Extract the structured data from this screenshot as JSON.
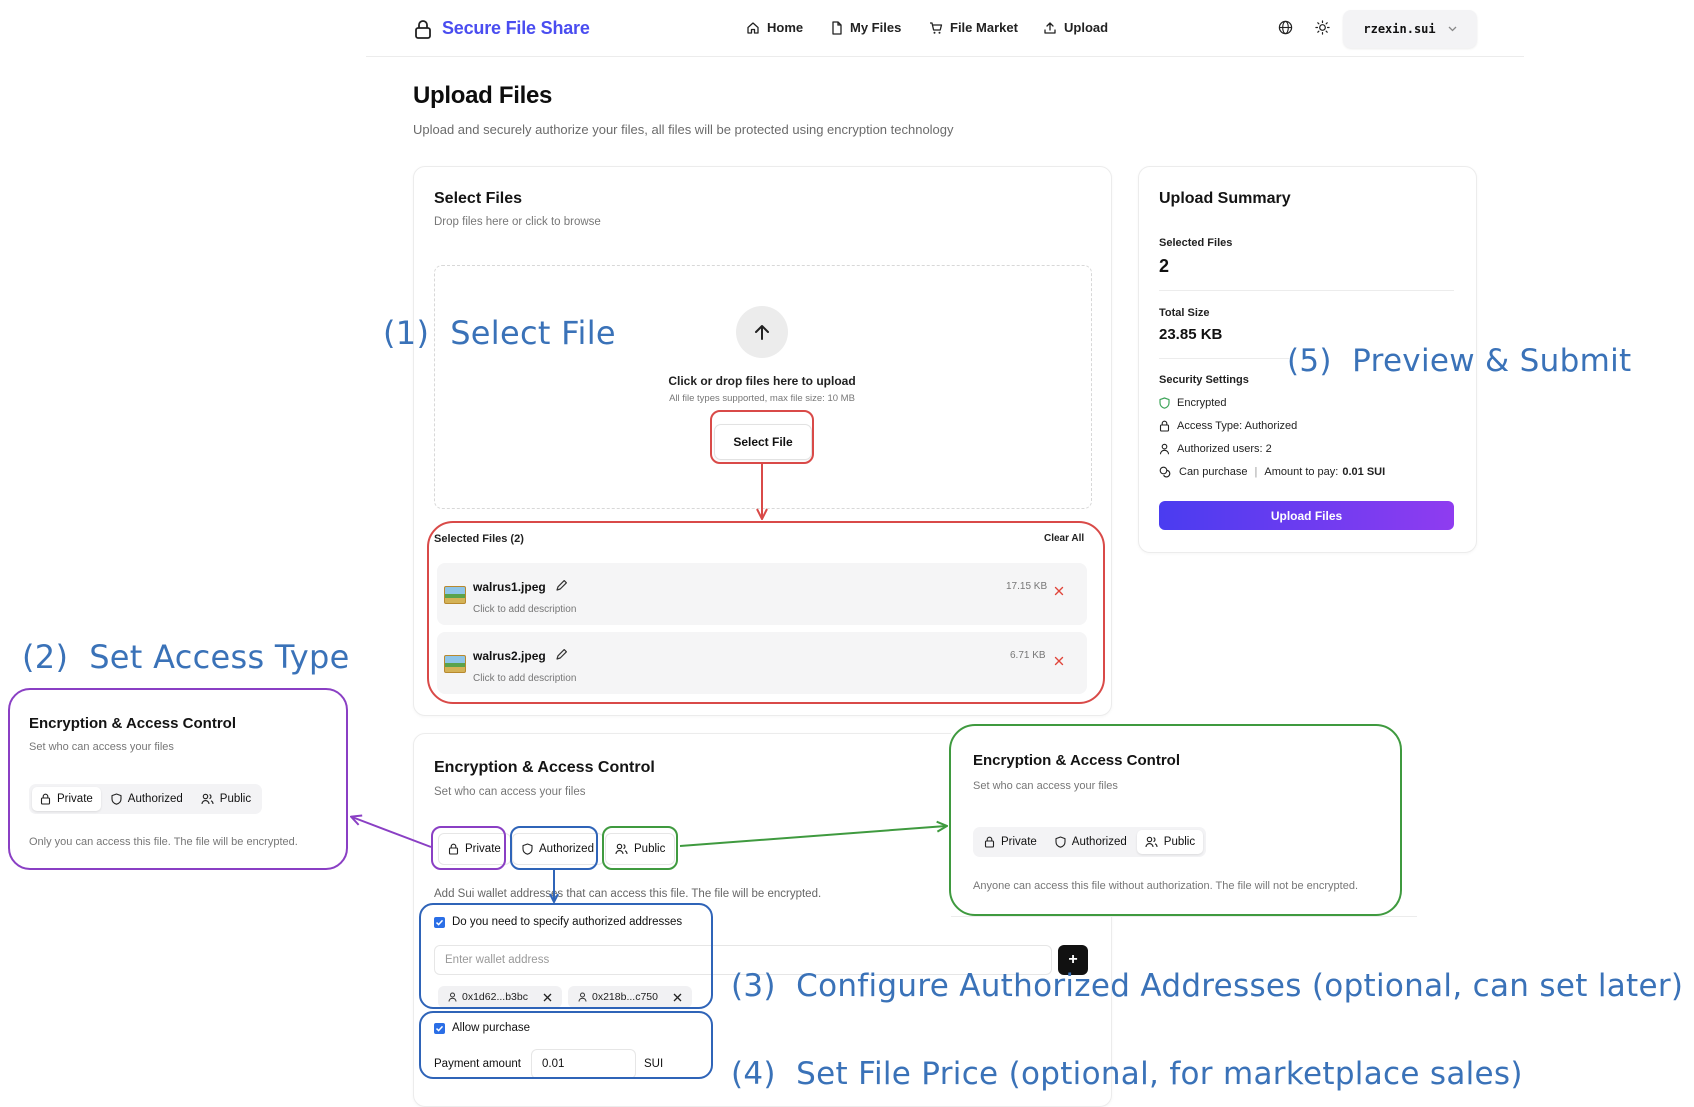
{
  "header": {
    "brand": "Secure File Share",
    "nav": [
      {
        "label": "Home",
        "icon": "home-icon"
      },
      {
        "label": "My Files",
        "icon": "file-icon"
      },
      {
        "label": "File Market",
        "icon": "cart-icon"
      },
      {
        "label": "Upload",
        "icon": "upload-icon"
      }
    ],
    "user": "rzexin.sui"
  },
  "page": {
    "title": "Upload Files",
    "subtitle": "Upload and securely authorize your files, all files will be protected using encryption technology"
  },
  "select_files": {
    "title": "Select Files",
    "subtitle": "Drop files here or click to browse",
    "drop_title": "Click or drop files here to upload",
    "drop_sub": "All file types supported, max file size: 10 MB",
    "select_button": "Select File",
    "selected_heading": "Selected Files (2)",
    "clear_all": "Clear All",
    "files": [
      {
        "name": "walrus1.jpeg",
        "description": "Click to add description",
        "size": "17.15 KB"
      },
      {
        "name": "walrus2.jpeg",
        "description": "Click to add description",
        "size": "6.71 KB"
      }
    ]
  },
  "access": {
    "title": "Encryption & Access Control",
    "subtitle": "Set who can access your files",
    "options": [
      "Private",
      "Authorized",
      "Public"
    ],
    "authorized_hint": "Add Sui wallet addresses that can access this file. The file will be encrypted.",
    "specify_label": "Do you need to specify authorized addresses",
    "wallet_placeholder": "Enter wallet address",
    "add_symbol": "+",
    "addresses": [
      "0x1d62...b3bc",
      "0x218b...c750"
    ],
    "allow_purchase_label": "Allow purchase",
    "payment_label": "Payment amount",
    "payment_value": "0.01",
    "payment_unit": "SUI"
  },
  "private_panel": {
    "title": "Encryption & Access Control",
    "subtitle": "Set who can access your files",
    "hint": "Only you can access this file. The file will be encrypted."
  },
  "public_panel": {
    "title": "Encryption & Access Control",
    "subtitle": "Set who can access your files",
    "hint": "Anyone can access this file without authorization. The file will not be encrypted."
  },
  "summary": {
    "title": "Upload Summary",
    "selected_label": "Selected Files",
    "selected_value": "2",
    "size_label": "Total Size",
    "size_value": "23.85 KB",
    "security_label": "Security Settings",
    "encrypted": "Encrypted",
    "access_type": "Access Type: Authorized",
    "authorized_users": "Authorized users: 2",
    "can_purchase": "Can purchase",
    "separator": "|",
    "amount_label": "Amount to pay:",
    "amount_value": "0.01 SUI",
    "upload_button": "Upload Files"
  },
  "annotations": {
    "step1": {
      "num": "(1)",
      "text": "Select File"
    },
    "step2": {
      "num": "(2)",
      "text": "Set Access Type"
    },
    "step3": {
      "num": "(3)",
      "text": "Configure Authorized Addresses (optional, can set later)"
    },
    "step4": {
      "num": "(4)",
      "text": "Set File Price (optional, for marketplace sales)"
    },
    "step5": {
      "num": "(5)",
      "text": "Preview & Submit"
    }
  },
  "colors": {
    "brand": "#4a4df0",
    "annotation_text": "#3a72b8",
    "red": "#d94a48",
    "purple": "#8a3fc4",
    "blue": "#2f64b8",
    "green": "#3f9a3f",
    "checkbox": "#2a6ee6"
  }
}
